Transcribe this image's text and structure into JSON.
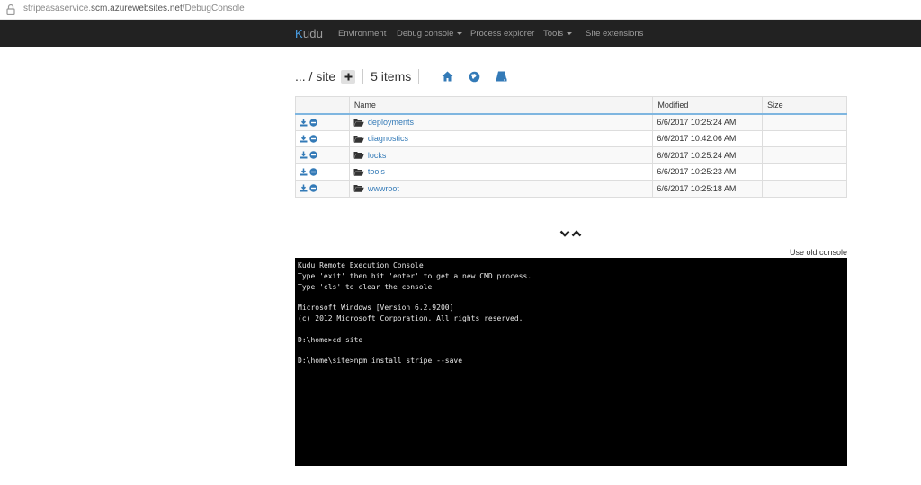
{
  "browser": {
    "url_prefix": "stripeasaservice.",
    "url_host": "scm.azurewebsites.net",
    "url_path": "/DebugConsole"
  },
  "navbar": {
    "brand_k": "K",
    "brand_rest": "udu",
    "items": [
      {
        "label": "Environment"
      },
      {
        "label": "Debug console",
        "dropdown": true
      },
      {
        "label": "Process explorer"
      },
      {
        "label": "Tools",
        "dropdown": true
      },
      {
        "label": "Site extensions"
      }
    ]
  },
  "breadcrumb": {
    "path": "... / site",
    "add_glyph": "+",
    "items_count": "5 items"
  },
  "table": {
    "headers": {
      "name": "Name",
      "modified": "Modified",
      "size": "Size"
    },
    "rows": [
      {
        "name": "deployments",
        "modified": "6/6/2017 10:25:24 AM",
        "size": ""
      },
      {
        "name": "diagnostics",
        "modified": "6/6/2017 10:42:06 AM",
        "size": ""
      },
      {
        "name": "locks",
        "modified": "6/6/2017 10:25:24 AM",
        "size": ""
      },
      {
        "name": "tools",
        "modified": "6/6/2017 10:25:23 AM",
        "size": ""
      },
      {
        "name": "wwwroot",
        "modified": "6/6/2017 10:25:18 AM",
        "size": ""
      }
    ]
  },
  "console": {
    "old_console_link": "Use old console",
    "lines": [
      "Kudu Remote Execution Console",
      "Type 'exit' then hit 'enter' to get a new CMD process.",
      "Type 'cls' to clear the console",
      "",
      "Microsoft Windows [Version 6.2.9200]",
      "(c) 2012 Microsoft Corporation. All rights reserved.",
      "",
      "D:\\home>cd site",
      "",
      "D:\\home\\site>npm install stripe --save"
    ]
  },
  "colors": {
    "navbar_bg": "#222222",
    "link": "#337ab7",
    "accent": "#4aa0e6",
    "console_bg": "#000000"
  },
  "icons": [
    "lock-icon",
    "plus-icon",
    "home-icon",
    "globe-icon",
    "drive-icon",
    "download-icon",
    "delete-icon",
    "folder-icon",
    "chevron-down-icon",
    "chevron-up-icon"
  ]
}
